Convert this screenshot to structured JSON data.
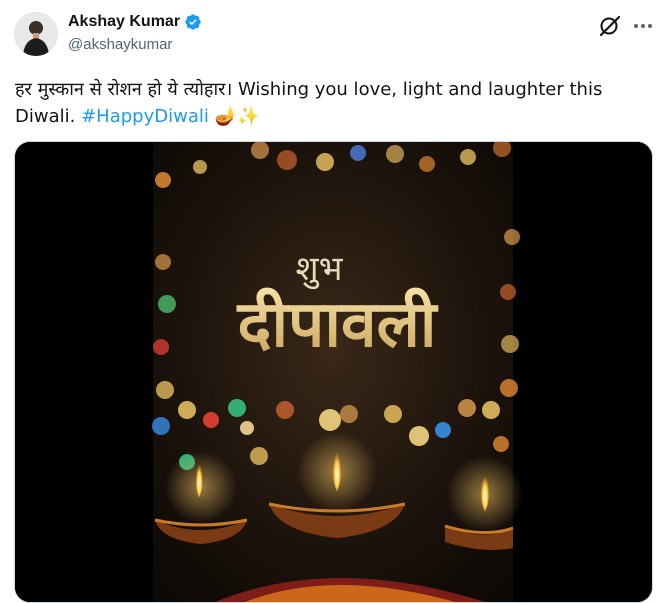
{
  "author": {
    "display_name": "Akshay Kumar",
    "handle": "@akshaykumar",
    "verified": true,
    "avatar_icon": "profile-photo"
  },
  "tweet": {
    "text": "हर मुस्कान से रोशन हो ये त्योहार।  Wishing you love, light and laughter this Diwali.",
    "hashtag": "#HappyDiwali",
    "emoji": "🪔✨"
  },
  "media": {
    "title_small": "शुभ",
    "title_large": "दीपावली"
  },
  "icons": {
    "grok": "grok-icon",
    "more": "more-options-icon",
    "verified": "verified-badge-icon"
  },
  "colors": {
    "accent": "#1d9bf0",
    "text": "#0f1419",
    "secondary_text": "#536471",
    "gold": "#e3c27a"
  }
}
